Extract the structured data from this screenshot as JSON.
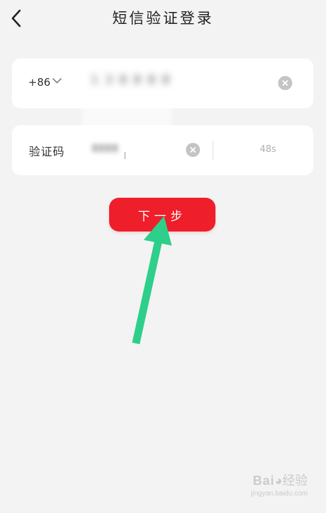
{
  "header": {
    "title": "短信验证登录",
    "back_icon": "chevron-left-icon"
  },
  "phone_card": {
    "country_code": "+86",
    "country_dropdown_icon": "chevron-down-icon",
    "phone_value": "",
    "clear_icon": "clear-circle-icon"
  },
  "code_card": {
    "label": "验证码",
    "code_value": "",
    "clear_icon": "clear-circle-icon",
    "countdown": "48s"
  },
  "actions": {
    "next_label": "下一步"
  },
  "annotation": {
    "arrow_color": "#2ecf8a"
  },
  "watermark": {
    "brand": "Bai",
    "brand_tail": "经验",
    "url": "jingyan.baidu.com"
  },
  "colors": {
    "background": "#f3f3f3",
    "card": "#ffffff",
    "primary": "#ee1e2a",
    "muted": "#b0b0b0"
  }
}
